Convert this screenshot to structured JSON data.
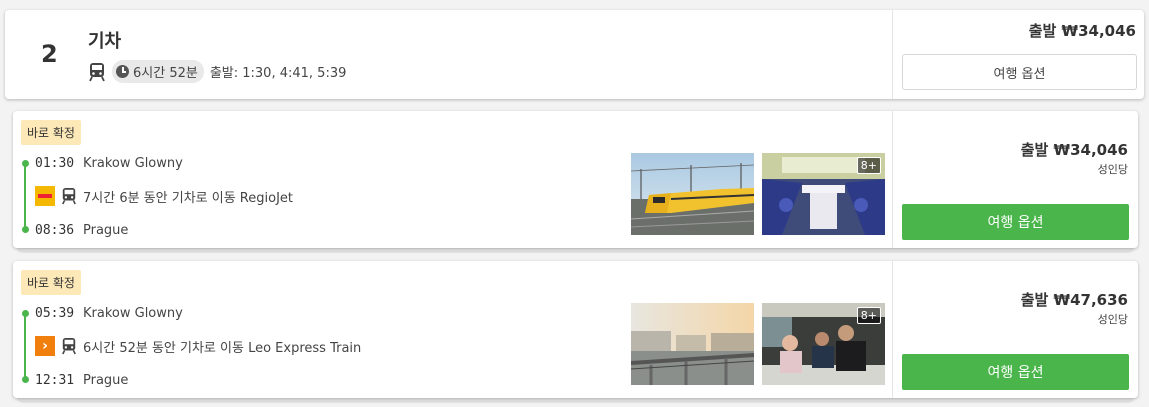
{
  "summary": {
    "count": "2",
    "mode": "기차",
    "duration": "6시간 52분",
    "departures": "출발: 1:30, 4:41, 5:39",
    "price": "출발 ₩34,046",
    "button": "여행 옵션"
  },
  "options": [
    {
      "badge": "바로 확정",
      "dep_time": "01:30",
      "dep_station": "Krakow Glowny",
      "segment": "7시간 6분 동안 기차로 이동 RegioJet",
      "arr_time": "08:36",
      "arr_station": "Prague",
      "price": "출발 ₩34,046",
      "unit": "성인당",
      "button": "여행 옵션",
      "photo_count": "8+",
      "operator_logo": "regiojet-logo"
    },
    {
      "badge": "바로 확정",
      "dep_time": "05:39",
      "dep_station": "Krakow Glowny",
      "segment": "6시간 52분 동안 기차로 이동 Leo Express Train",
      "arr_time": "12:31",
      "arr_station": "Prague",
      "price": "출발 ₩47,636",
      "unit": "성인당",
      "button": "여행 옵션",
      "photo_count": "8+",
      "operator_logo": "leo-express-logo"
    }
  ],
  "colors": {
    "accent_green": "#4ab54b",
    "badge_bg": "#fde8b8",
    "regiojet_yellow": "#f5b800",
    "leo_orange": "#f07f0e"
  }
}
